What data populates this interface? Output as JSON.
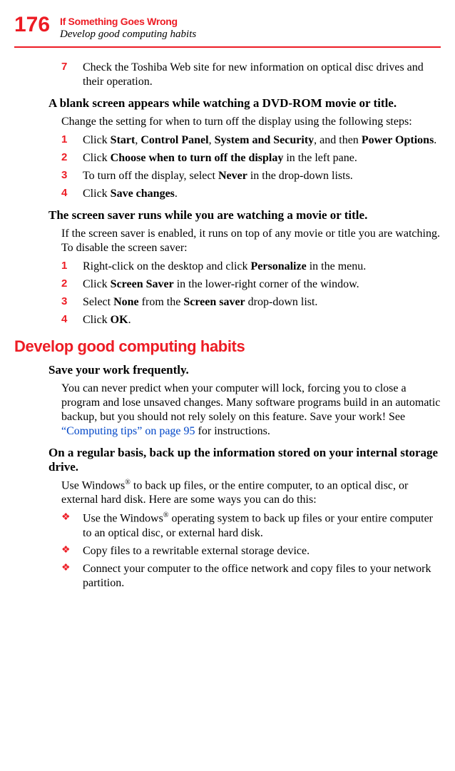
{
  "header": {
    "page_num": "176",
    "title": "If Something Goes Wrong",
    "subtitle": "Develop good computing habits"
  },
  "step7": {
    "n": "7",
    "text_a": "Check the Toshiba Web site for new information on optical disc drives and their operation."
  },
  "topicA": {
    "title": "A blank screen appears while watching a DVD-ROM movie or title.",
    "para": "Change the setting for when to turn off the display using the following steps:",
    "steps": [
      {
        "n": "1",
        "pre": "Click ",
        "b1": "Start",
        "m1": ", ",
        "b2": "Control Panel",
        "m2": ", ",
        "b3": "System and Security",
        "m3": ", and then ",
        "b4": "Power Options",
        "post": "."
      },
      {
        "n": "2",
        "pre": "Click ",
        "b1": "Choose when to turn off the display",
        "post": " in the left pane."
      },
      {
        "n": "3",
        "pre": "To turn off the display, select ",
        "b1": "Never",
        "post": " in the drop-down lists."
      },
      {
        "n": "4",
        "pre": "Click ",
        "b1": "Save changes",
        "post": "."
      }
    ]
  },
  "topicB": {
    "title": "The screen saver runs while you are watching a movie or title.",
    "para": "If the screen saver is enabled, it runs on top of any movie or title you are watching. To disable the screen saver:",
    "steps": [
      {
        "n": "1",
        "pre": "Right-click on the desktop and click ",
        "b1": "Personalize",
        "post": " in the menu."
      },
      {
        "n": "2",
        "pre": "Click ",
        "b1": "Screen Saver",
        "post": " in the lower-right corner of the window."
      },
      {
        "n": "3",
        "pre": "Select ",
        "b1": "None",
        "m1": " from the ",
        "b2": "Screen saver",
        "post": " drop-down list."
      },
      {
        "n": "4",
        "pre": "Click ",
        "b1": "OK",
        "post": "."
      }
    ]
  },
  "sectionC": {
    "h2": "Develop good computing habits",
    "sub1_title": "Save your work frequently.",
    "sub1_para_a": "You can never predict when your computer will lock, forcing you to close a program and lose unsaved changes. Many software programs build in an automatic backup, but you should not rely solely on this feature. Save your work! See ",
    "sub1_link": "“Computing tips” on page 95",
    "sub1_para_b": " for instructions.",
    "sub2_title": "On a regular basis, back up the information stored on your internal storage drive.",
    "sub2_para_a": "Use Windows",
    "sub2_reg1": "®",
    "sub2_para_b": " to back up files, or the entire computer, to an optical disc, or external hard disk. Here are some ways you can do this:",
    "bullets": [
      {
        "sym": "❖",
        "pre": "Use the Windows",
        "reg": "®",
        "post": " operating system to back up files or your entire computer to an optical disc, or external hard disk."
      },
      {
        "sym": "❖",
        "text": "Copy files to a rewritable external storage device."
      },
      {
        "sym": "❖",
        "text": "Connect your computer to the office network and copy files to your network partition."
      }
    ]
  }
}
